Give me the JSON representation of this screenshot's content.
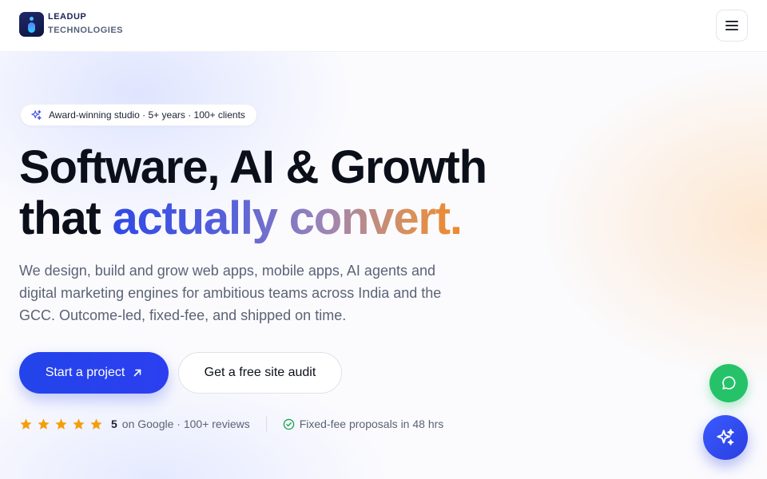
{
  "brand": {
    "line1": "LEADUP",
    "line2": "TECHNOLOGIES",
    "icon": "leadup-logo-icon"
  },
  "header": {
    "menu_icon": "hamburger-menu-icon"
  },
  "hero": {
    "badge": {
      "icon": "sparkles-icon",
      "text": "Award-winning studio · 5+ years · 100+ clients"
    },
    "headline": {
      "line1": "Software, AI & Growth",
      "line2_plain": "that",
      "line2_accent": "actually convert."
    },
    "subtitle": "We design, build and grow web apps, mobile apps, AI agents and digital marketing engines for ambitious teams across India and the GCC. Outcome-led, fixed-fee, and shipped on time.",
    "primary_cta": "Start a project",
    "secondary_cta": "Get a free site audit",
    "rating": {
      "stars": 5,
      "value": "5",
      "text": "on Google · 100+ reviews"
    },
    "guarantee": "Fixed-fee proposals in 48 hrs"
  },
  "floating": {
    "chat_icon": "whatsapp-chat-icon",
    "ai_icon": "ai-sparkle-icon"
  },
  "colors": {
    "primary": "#2344ea",
    "accent_start": "#2f49e6",
    "accent_end": "#f08a2a",
    "star": "#f59e0b",
    "chat_green": "#25c26a",
    "check_green": "#16a34a"
  }
}
